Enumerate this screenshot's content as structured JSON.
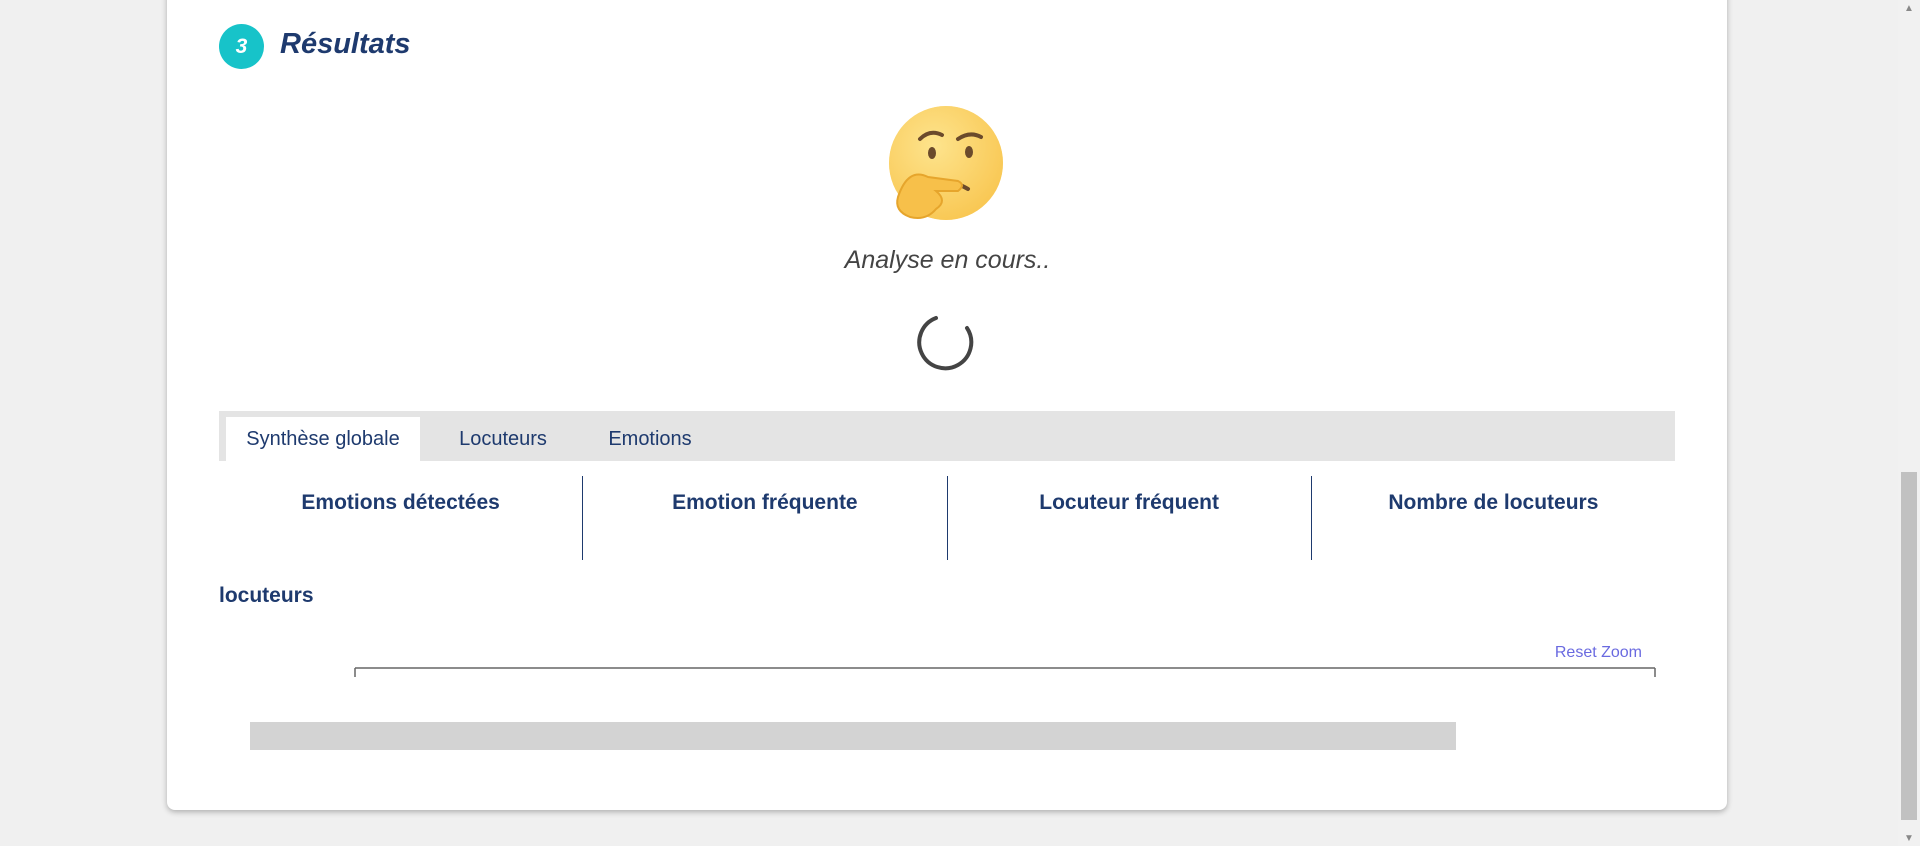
{
  "section": {
    "step_number": "3",
    "title": "Résultats"
  },
  "status": {
    "emoji_icon": "thinking-face-icon",
    "message": "Analyse en cours.."
  },
  "tabs": [
    {
      "label": "Synthèse globale",
      "active": true
    },
    {
      "label": "Locuteurs",
      "active": false
    },
    {
      "label": "Emotions",
      "active": false
    }
  ],
  "stats": [
    {
      "label": "Emotions détectées"
    },
    {
      "label": "Emotion fréquente"
    },
    {
      "label": "Locuteur fréquent"
    },
    {
      "label": "Nombre de locuteurs"
    }
  ],
  "chart": {
    "heading": "locuteurs",
    "reset_zoom_label": "Reset Zoom"
  },
  "colors": {
    "accent": "#17c3c9",
    "heading": "#1e3a6e",
    "reset_zoom": "#6a6ae0",
    "placeholder_bar": "#d3d3d3"
  }
}
